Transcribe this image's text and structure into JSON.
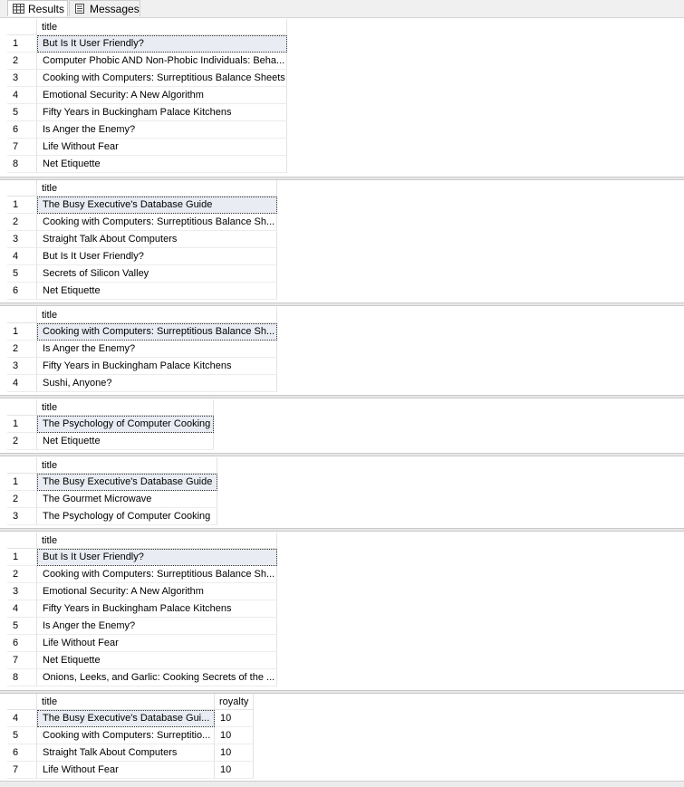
{
  "tabs": [
    {
      "label": "Results",
      "icon": "grid-icon",
      "active": true
    },
    {
      "label": "Messages",
      "icon": "document-icon",
      "active": false
    }
  ],
  "grids": [
    {
      "columns": [
        "title"
      ],
      "rows": [
        {
          "n": "1",
          "cells": [
            "But Is It User Friendly?"
          ]
        },
        {
          "n": "2",
          "cells": [
            "Computer Phobic AND Non-Phobic Individuals: Beha..."
          ]
        },
        {
          "n": "3",
          "cells": [
            "Cooking with Computers: Surreptitious Balance Sheets"
          ]
        },
        {
          "n": "4",
          "cells": [
            "Emotional Security: A New Algorithm"
          ]
        },
        {
          "n": "5",
          "cells": [
            "Fifty Years in Buckingham Palace Kitchens"
          ]
        },
        {
          "n": "6",
          "cells": [
            "Is Anger the Enemy?"
          ]
        },
        {
          "n": "7",
          "cells": [
            "Life Without Fear"
          ]
        },
        {
          "n": "8",
          "cells": [
            "Net Etiquette"
          ]
        }
      ]
    },
    {
      "columns": [
        "title"
      ],
      "rows": [
        {
          "n": "1",
          "cells": [
            "The Busy Executive's Database Guide"
          ]
        },
        {
          "n": "2",
          "cells": [
            "Cooking with Computers: Surreptitious Balance Sh..."
          ]
        },
        {
          "n": "3",
          "cells": [
            "Straight Talk About Computers"
          ]
        },
        {
          "n": "4",
          "cells": [
            "But Is It User Friendly?"
          ]
        },
        {
          "n": "5",
          "cells": [
            "Secrets of Silicon Valley"
          ]
        },
        {
          "n": "6",
          "cells": [
            "Net Etiquette"
          ]
        }
      ]
    },
    {
      "columns": [
        "title"
      ],
      "rows": [
        {
          "n": "1",
          "cells": [
            "Cooking with Computers: Surreptitious Balance Sh..."
          ]
        },
        {
          "n": "2",
          "cells": [
            "Is Anger the Enemy?"
          ]
        },
        {
          "n": "3",
          "cells": [
            "Fifty Years in Buckingham Palace Kitchens"
          ]
        },
        {
          "n": "4",
          "cells": [
            "Sushi, Anyone?"
          ]
        }
      ]
    },
    {
      "columns": [
        "title"
      ],
      "rows": [
        {
          "n": "1",
          "cells": [
            "The Psychology of Computer Cooking"
          ]
        },
        {
          "n": "2",
          "cells": [
            "Net Etiquette"
          ]
        }
      ]
    },
    {
      "columns": [
        "title"
      ],
      "rows": [
        {
          "n": "1",
          "cells": [
            "The Busy Executive's Database Guide"
          ]
        },
        {
          "n": "2",
          "cells": [
            "The Gourmet Microwave"
          ]
        },
        {
          "n": "3",
          "cells": [
            "The Psychology of Computer Cooking"
          ]
        }
      ]
    },
    {
      "columns": [
        "title"
      ],
      "rows": [
        {
          "n": "1",
          "cells": [
            "But Is It User Friendly?"
          ]
        },
        {
          "n": "2",
          "cells": [
            "Cooking with Computers: Surreptitious Balance Sh..."
          ]
        },
        {
          "n": "3",
          "cells": [
            "Emotional Security: A New Algorithm"
          ]
        },
        {
          "n": "4",
          "cells": [
            "Fifty Years in Buckingham Palace Kitchens"
          ]
        },
        {
          "n": "5",
          "cells": [
            "Is Anger the Enemy?"
          ]
        },
        {
          "n": "6",
          "cells": [
            "Life Without Fear"
          ]
        },
        {
          "n": "7",
          "cells": [
            "Net Etiquette"
          ]
        },
        {
          "n": "8",
          "cells": [
            "Onions, Leeks, and Garlic: Cooking Secrets of the ..."
          ]
        }
      ]
    },
    {
      "columns": [
        "title",
        "royalty"
      ],
      "rows": [
        {
          "n": "4",
          "cells": [
            "The Busy Executive's Database Gui...",
            "10"
          ]
        },
        {
          "n": "5",
          "cells": [
            "Cooking with Computers: Surreptitio...",
            "10"
          ]
        },
        {
          "n": "6",
          "cells": [
            "Straight Talk About Computers",
            "10"
          ]
        },
        {
          "n": "7",
          "cells": [
            "Life Without Fear",
            "10"
          ]
        }
      ]
    }
  ]
}
